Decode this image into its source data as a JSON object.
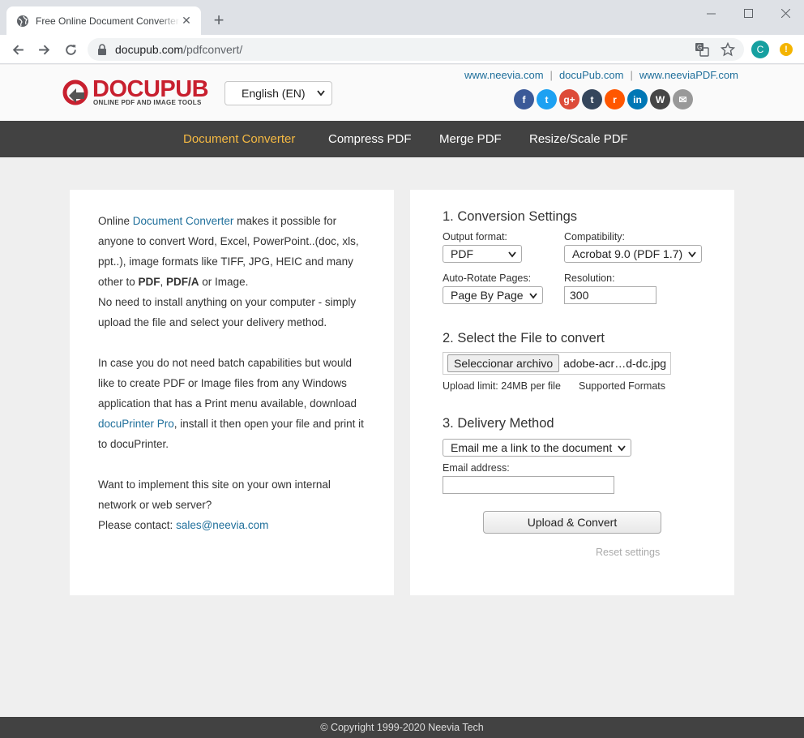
{
  "browser": {
    "tab_title": "Free Online Document Converter",
    "url_host": "docupub.com",
    "url_path": "/pdfconvert/",
    "profile_initial": "C",
    "alert_symbol": "!"
  },
  "header": {
    "logo_word": "DOCUPUB",
    "logo_tagline": "ONLINE PDF AND IMAGE TOOLS",
    "language": "English (EN)",
    "links": [
      "www.neevia.com",
      "docuPub.com",
      "www.neeviaPDF.com"
    ],
    "social": [
      {
        "name": "facebook-icon",
        "glyph": "f",
        "color": "#3b5998"
      },
      {
        "name": "twitter-icon",
        "glyph": "t",
        "color": "#1da1f2"
      },
      {
        "name": "google-plus-icon",
        "glyph": "g+",
        "color": "#dd4b39"
      },
      {
        "name": "tumblr-icon",
        "glyph": "t",
        "color": "#35465c"
      },
      {
        "name": "reddit-icon",
        "glyph": "r",
        "color": "#ff5700"
      },
      {
        "name": "linkedin-icon",
        "glyph": "in",
        "color": "#0077b5"
      },
      {
        "name": "wordpress-icon",
        "glyph": "W",
        "color": "#464646"
      },
      {
        "name": "email-icon",
        "glyph": "✉",
        "color": "#999999"
      }
    ]
  },
  "nav": {
    "items": [
      "Document Converter",
      "Compress PDF",
      "Merge PDF",
      "Resize/Scale PDF"
    ],
    "active": "Document Converter"
  },
  "intro": {
    "p1_a": "Online ",
    "p1_link": "Document Converter",
    "p1_b": " makes it possible for anyone to convert Word, Excel, PowerPoint..(doc, xls, ppt..), image formats like TIFF, JPG, HEIC and many other to ",
    "p1_bold1": "PDF",
    "p1_c": ", ",
    "p1_bold2": "PDF/A",
    "p1_d": " or Image.",
    "p1_e": "No need to install anything on your computer - simply upload the file and select your delivery method.",
    "p2_a": "In case you do not need batch capabilities but would like to create PDF or Image files from any Windows application that has a Print menu available, download ",
    "p2_link": "docuPrinter Pro",
    "p2_b": ", install it then open your file and print it to docuPrinter.",
    "p3_a": "Want to implement this site on your own internal network or web server?",
    "p3_b": "Please contact: ",
    "p3_link": "sales@neevia.com"
  },
  "form": {
    "section1": "1. Conversion Settings",
    "output_format_label": "Output format:",
    "output_format": "PDF",
    "compat_label": "Compatibility:",
    "compat": "Acrobat 9.0 (PDF 1.7)",
    "rotate_label": "Auto-Rotate Pages:",
    "rotate": "Page By Page",
    "resolution_label": "Resolution:",
    "resolution": "300",
    "section2": "2. Select the File to convert",
    "file_button": "Seleccionar archivo",
    "file_name": "adobe-acr…d-dc.jpg",
    "upload_limit": "Upload limit: 24MB per file",
    "supported_formats": "Supported Formats",
    "section3": "3. Delivery Method",
    "delivery": "Email me a link to the document",
    "email_label": "Email address:",
    "email_value": "",
    "submit": "Upload & Convert",
    "reset": "Reset settings"
  },
  "footer": {
    "copyright": "© Copyright 1999-2020 Neevia Tech"
  }
}
